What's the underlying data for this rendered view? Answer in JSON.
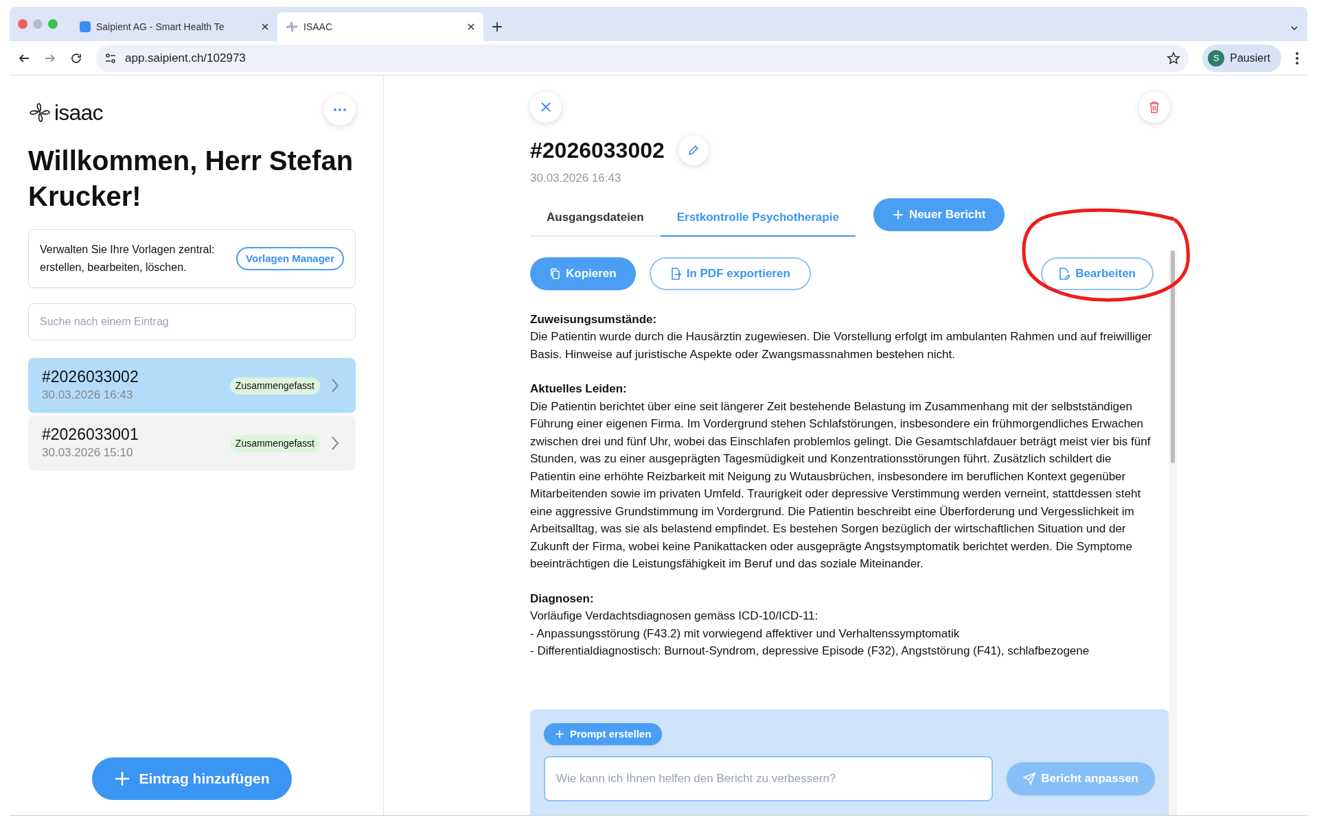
{
  "browser": {
    "tabs": [
      {
        "title": "Saipient AG - Smart Health Te",
        "selected": false
      },
      {
        "title": "ISAAC",
        "selected": true
      }
    ],
    "url": "app.saipient.ch/102973",
    "profile": {
      "initial": "S",
      "label": "Pausiert"
    }
  },
  "sidebar": {
    "logo": "isaac",
    "greeting": "Willkommen, Herr Stefan Krucker!",
    "templates_card": {
      "text": "Verwalten Sie Ihre Vorlagen zentral: erstellen, bearbeiten, löschen.",
      "button": "Vorlagen Manager"
    },
    "search": {
      "placeholder": "Suche nach einem Eintrag"
    },
    "entries": [
      {
        "id": "#2026033002",
        "date": "30.03.2026 16:43",
        "status": "Zusammengefasst",
        "selected": true
      },
      {
        "id": "#2026033001",
        "date": "30.03.2026 15:10",
        "status": "Zusammengefasst",
        "selected": false
      }
    ],
    "add_button": "Eintrag hinzufügen"
  },
  "main": {
    "title": "#2026033002",
    "date": "30.03.2026 16:43",
    "tabs": [
      {
        "label": "Ausgangsdateien",
        "selected": false
      },
      {
        "label": "Erstkontrolle Psychotherapie",
        "selected": true
      }
    ],
    "new_report_button": "Neuer Bericht",
    "actions": [
      {
        "label": "Kopieren",
        "kind": "primary"
      },
      {
        "label": "In PDF exportieren",
        "kind": "outline"
      }
    ],
    "edit_button": "Bearbeiten",
    "report": [
      {
        "heading": "Zuweisungsumstände:",
        "lines": [
          "Die Patientin wurde durch die Hausärztin zugewiesen. Die Vorstellung erfolgt im ambulanten Rahmen und auf freiwilliger Basis. Hinweise auf juristische Aspekte oder Zwangsmassnahmen bestehen nicht."
        ]
      },
      {
        "heading": "Aktuelles Leiden:",
        "lines": [
          "Die Patientin berichtet über eine seit längerer Zeit bestehende Belastung im Zusammenhang mit der selbstständigen Führung einer eigenen Firma. Im Vordergrund stehen Schlafstörungen, insbesondere ein frühmorgendliches Erwachen zwischen drei und fünf Uhr, wobei das Einschlafen problemlos gelingt. Die Gesamtschlafdauer beträgt meist vier bis fünf Stunden, was zu einer ausgeprägten Tagesmüdigkeit und Konzentrationsstörungen führt. Zusätzlich schildert die Patientin eine erhöhte Reizbarkeit mit Neigung zu Wutausbrüchen, insbesondere im beruflichen Kontext gegenüber Mitarbeitenden sowie im privaten Umfeld. Traurigkeit oder depressive Verstimmung werden verneint, stattdessen steht eine aggressive Grundstimmung im Vordergrund. Die Patientin beschreibt eine Überforderung und Vergesslichkeit im Arbeitsalltag, was sie als belastend empfindet. Es bestehen Sorgen bezüglich der wirtschaftlichen Situation und der Zukunft der Firma, wobei keine Panikattacken oder ausgeprägte Angstsymptomatik berichtet werden. Die Symptome beeinträchtigen die Leistungsfähigkeit im Beruf und das soziale Miteinander."
        ]
      },
      {
        "heading": "Diagnosen:",
        "lines": [
          "Vorläufige Verdachtsdiagnosen gemäss ICD-10/ICD-11:",
          "- Anpassungsstörung (F43.2) mit vorwiegend affektiver und Verhaltenssymptomatik",
          "- Differentialdiagnostisch: Burnout-Syndrom, depressive Episode (F32), Angststörung (F41), schlafbezogene"
        ]
      }
    ],
    "prompt": {
      "button": "Prompt erstellen",
      "placeholder": "Wie kann ich Ihnen helfen den Bericht zu verbessern?",
      "submit": "Bericht anpassen",
      "submit_disabled": true
    }
  }
}
